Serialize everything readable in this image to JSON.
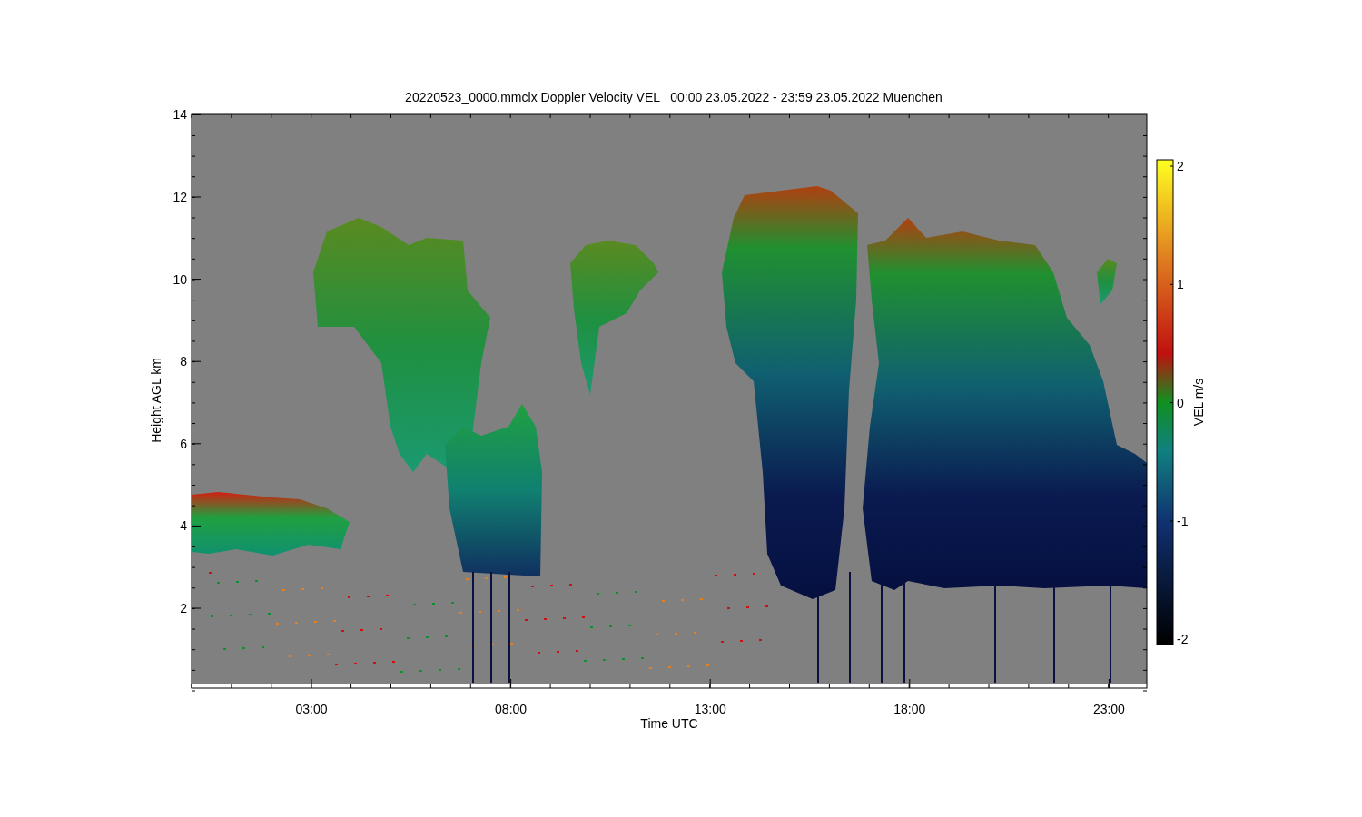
{
  "title": "20220523_0000.mmclx Doppler Velocity VEL   00:00 23.05.2022 - 23:59 23.05.2022 Muenchen",
  "plot": {
    "x_axis": {
      "label": "Time UTC",
      "ticks": [
        "03:00",
        "08:00",
        "13:00",
        "18:00",
        "23:00"
      ]
    },
    "y_axis": {
      "label": "Height AGL km",
      "ticks": [
        "14",
        "12",
        "10",
        "8",
        "6",
        "4",
        "2"
      ]
    },
    "colorbar": {
      "label": "VEL m/s",
      "ticks": [
        "2",
        "1",
        "0",
        "-1",
        "-2"
      ]
    }
  }
}
